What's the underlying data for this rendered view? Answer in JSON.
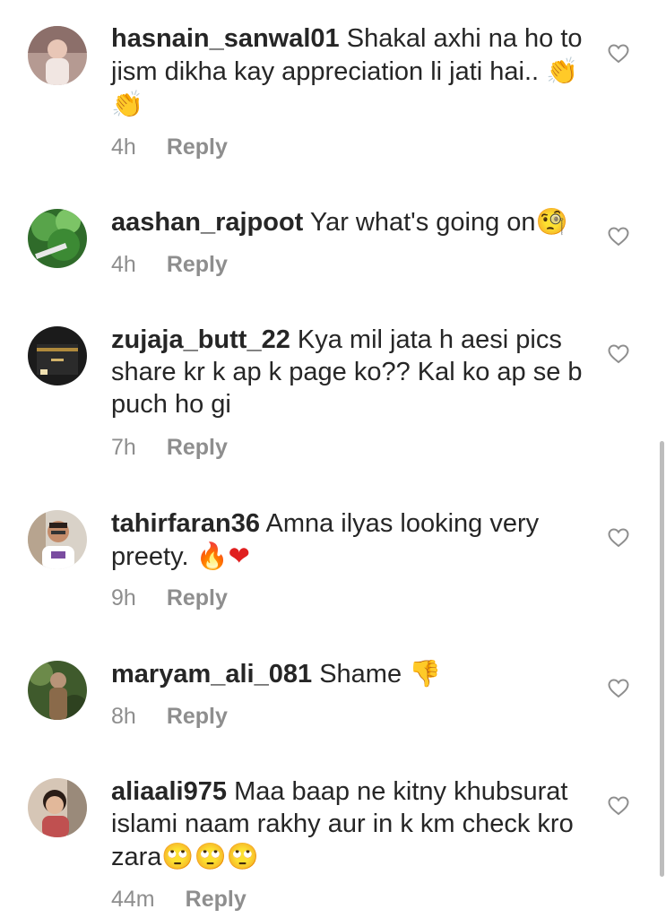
{
  "comments": [
    {
      "username": "hasnain_sanwal01",
      "text": "Shakal axhi na ho to jism dikha kay appreciation li jati hai..",
      "emoji": "👏 👏",
      "time": "4h",
      "reply": "Reply"
    },
    {
      "username": "aashan_rajpoot",
      "text": "Yar what's going on",
      "emoji": "🧐",
      "time": "4h",
      "reply": "Reply"
    },
    {
      "username": "zujaja_butt_22",
      "text": "Kya mil jata h aesi pics share kr k ap k page ko?? Kal ko ap se b puch ho gi",
      "emoji": "",
      "time": "7h",
      "reply": "Reply"
    },
    {
      "username": "tahirfaran36",
      "text": "Amna ilyas looking very preety.",
      "emoji": "🔥❤",
      "time": "9h",
      "reply": "Reply"
    },
    {
      "username": "maryam_ali_081",
      "text": "Shame",
      "emoji": "👎",
      "time": "8h",
      "reply": "Reply"
    },
    {
      "username": "aliaali975",
      "text": "Maa baap ne kitny khubsurat islami naam rakhy aur in k km check kro zara",
      "emoji": "🙄🙄🙄",
      "time": "44m",
      "reply": "Reply"
    }
  ],
  "icons": {
    "like": "heart-outline-icon"
  },
  "colors": {
    "text": "#262626",
    "meta": "#8e8e8e",
    "heart": "#8e8e8e"
  }
}
